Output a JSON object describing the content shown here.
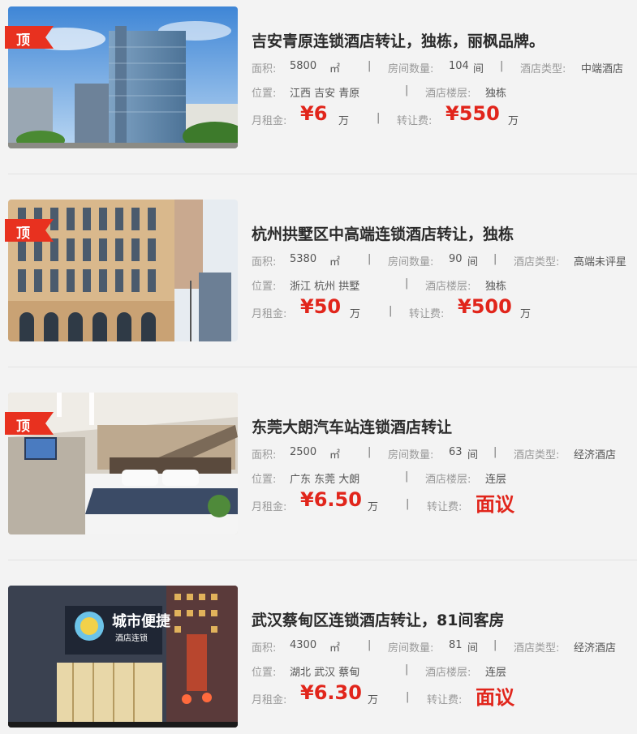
{
  "labels": {
    "area": "面积:",
    "rooms": "房间数量:",
    "type": "酒店类型:",
    "location": "位置:",
    "floors": "酒店楼层:",
    "rent": "月租金:",
    "fee": "转让费:",
    "area_unit": "㎡",
    "room_unit": "间",
    "money_unit": "万",
    "separator": "|"
  },
  "top_badge": "顶",
  "listings": [
    {
      "title": "吉安青原连锁酒店转让，独栋，丽枫品牌。",
      "area": "5800",
      "rooms": "104",
      "type": "中端酒店",
      "location": "江西 吉安 青原",
      "floors": "独栋",
      "rent": "¥6",
      "fee": "¥550",
      "fee_has_unit": true
    },
    {
      "title": "杭州拱墅区中高端连锁酒店转让，独栋",
      "area": "5380",
      "rooms": "90",
      "type": "高端未评星",
      "location": "浙江 杭州 拱墅",
      "floors": "独栋",
      "rent": "¥50",
      "fee": "¥500",
      "fee_has_unit": true
    },
    {
      "title": "东莞大朗汽车站连锁酒店转让",
      "area": "2500",
      "rooms": "63",
      "type": "经济酒店",
      "location": "广东 东莞 大朗",
      "floors": "连层",
      "rent": "¥6.50",
      "fee": "面议",
      "fee_has_unit": false
    },
    {
      "title": "武汉蔡甸区连锁酒店转让，81间客房",
      "area": "4300",
      "rooms": "81",
      "type": "经济酒店",
      "location": "湖北 武汉 蔡甸",
      "floors": "连层",
      "rent": "¥6.30",
      "fee": "面议",
      "fee_has_unit": false
    }
  ],
  "photo4_sign": {
    "brand": "城市便捷",
    "sub": "酒店连锁"
  },
  "colors": {
    "accent_red": "#e1251b",
    "badge_red": "#e8311f"
  }
}
